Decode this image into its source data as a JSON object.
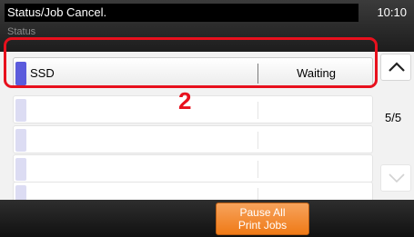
{
  "header": {
    "title": "Status/Job Cancel.",
    "time": "10:10",
    "subtitle": "Status"
  },
  "jobs": [
    {
      "name": "SSD",
      "status": "Waiting"
    },
    {
      "name": "",
      "status": ""
    },
    {
      "name": "",
      "status": ""
    },
    {
      "name": "",
      "status": ""
    },
    {
      "name": "",
      "status": ""
    }
  ],
  "annotation": {
    "step_number": "2",
    "color": "#e8101d"
  },
  "pager": {
    "page": "5/5",
    "up_icon": "chevron-up-icon",
    "down_icon": "chevron-down-icon"
  },
  "footer": {
    "pause_line1": "Pause All",
    "pause_line2": "Print Jobs",
    "accent": "#ef7a17"
  },
  "colors": {
    "selected_marker": "#5b5bdc",
    "unselected_marker": "#dcdcf3"
  }
}
